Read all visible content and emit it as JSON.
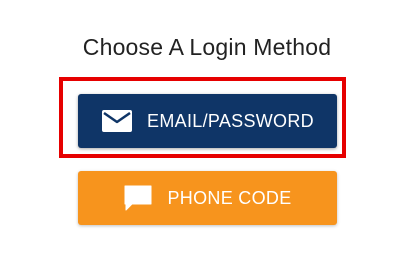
{
  "page": {
    "title": "Choose A Login Method"
  },
  "buttons": {
    "email": {
      "label": "EMAIL/PASSWORD",
      "icon": "envelope-icon",
      "color": "#0f3567"
    },
    "phone": {
      "label": "PHONE CODE",
      "icon": "chat-bubble-icon",
      "color": "#f7941d"
    }
  },
  "highlight": {
    "color": "#e60000",
    "target": "email-password-button"
  }
}
